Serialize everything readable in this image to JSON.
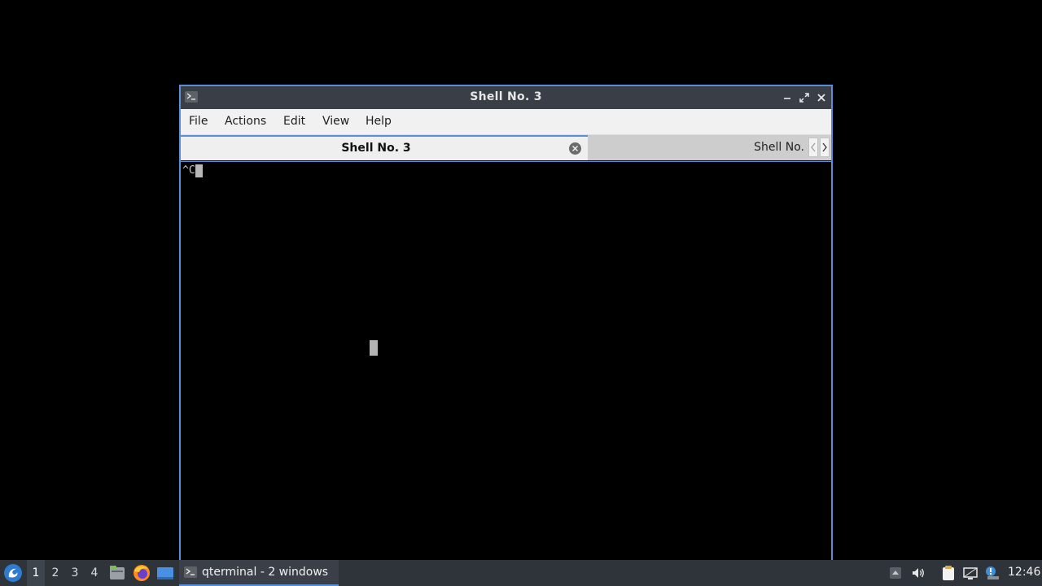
{
  "window": {
    "title": "Shell No. 3",
    "menu": [
      "File",
      "Actions",
      "Edit",
      "View",
      "Help"
    ],
    "tabs": [
      {
        "label": "Shell No. 3",
        "active": true
      },
      {
        "label": "Shell No.",
        "active": false
      }
    ],
    "terminal_text": "^C"
  },
  "taskbar": {
    "workspaces": [
      "1",
      "2",
      "3",
      "4"
    ],
    "active_workspace": "1",
    "launchers": [
      "file-manager-icon",
      "firefox-icon",
      "show-desktop-icon"
    ],
    "tasks": [
      {
        "label": "qterminal - 2 windows",
        "icon": "terminal-icon"
      }
    ],
    "tray": [
      "tray-expand-icon",
      "volume-icon",
      "clipboard-icon",
      "network-icon",
      "update-notifier-icon"
    ],
    "clock": "12:46"
  },
  "colors": {
    "accent": "#5a8fd8",
    "titlebar": "#3a3f47",
    "taskbar": "#2f343b",
    "terminal_bg": "#000000"
  }
}
